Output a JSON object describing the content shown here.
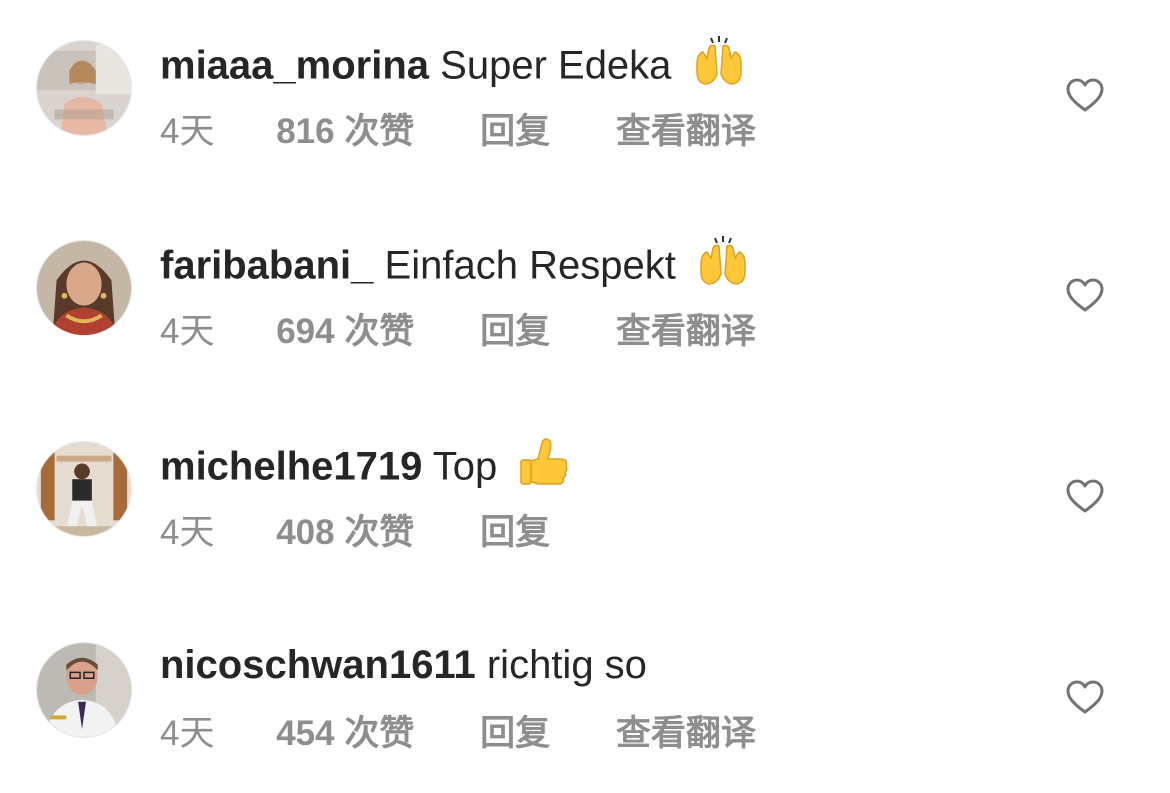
{
  "comments": [
    {
      "username": "miaaa_morina",
      "text": "Super Edeka",
      "emoji": "raising-hands-emoji",
      "time": "4天",
      "likes": "816 次赞",
      "reply": "回复",
      "translate": "查看翻译"
    },
    {
      "username": "faribabani_",
      "text": "Einfach Respekt",
      "emoji": "raising-hands-emoji",
      "time": "4天",
      "likes": "694 次赞",
      "reply": "回复",
      "translate": "查看翻译"
    },
    {
      "username": "michelhe1719",
      "text": "Top",
      "emoji": "thumbs-up-emoji",
      "time": "4天",
      "likes": "408 次赞",
      "reply": "回复"
    },
    {
      "username": "nicoschwan1611",
      "text": "richtig so",
      "time": "4天",
      "likes": "454 次赞",
      "reply": "回复",
      "translate": "查看翻译"
    }
  ],
  "colors": {
    "text": "#262626",
    "secondary": "#8e8e8e",
    "emoji_yellow": "#ffcc33"
  }
}
